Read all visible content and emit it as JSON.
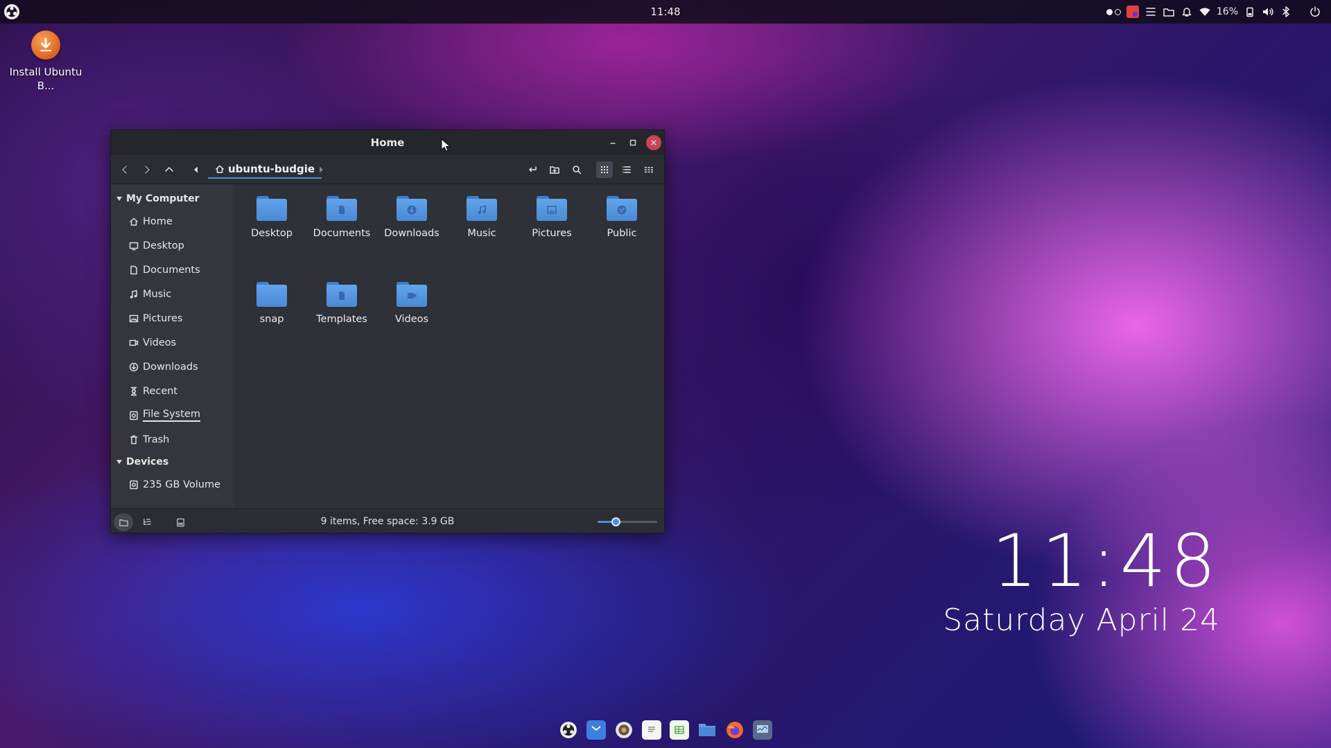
{
  "top_panel": {
    "clock": "11:48",
    "battery": "16%",
    "icons": [
      "budgie-menu-icon",
      "workspace-dots-icon",
      "app-indicator-icon",
      "hamburger-icon",
      "folder-icon",
      "bell-icon",
      "wifi-icon",
      "battery-icon",
      "volume-icon",
      "bluetooth-icon",
      "power-icon"
    ]
  },
  "desktop": {
    "install_label": "Install Ubuntu B...",
    "clock_time": "11:48",
    "clock_date": "Saturday April 24"
  },
  "window": {
    "title": "Home",
    "breadcrumb": "ubuntu-budgie",
    "sidebar": {
      "section_computer": "My Computer",
      "items": [
        {
          "label": "Home",
          "icon": "home-icon"
        },
        {
          "label": "Desktop",
          "icon": "desktop-icon"
        },
        {
          "label": "Documents",
          "icon": "document-icon"
        },
        {
          "label": "Music",
          "icon": "music-icon"
        },
        {
          "label": "Pictures",
          "icon": "picture-icon"
        },
        {
          "label": "Videos",
          "icon": "video-icon"
        },
        {
          "label": "Downloads",
          "icon": "download-icon"
        },
        {
          "label": "Recent",
          "icon": "hourglass-icon"
        },
        {
          "label": "File System",
          "icon": "drive-icon"
        },
        {
          "label": "Trash",
          "icon": "trash-icon"
        }
      ],
      "section_devices": "Devices",
      "devices": [
        {
          "label": "235 GB Volume",
          "icon": "drive-icon"
        }
      ]
    },
    "files": [
      {
        "label": "Desktop",
        "emblem": "none"
      },
      {
        "label": "Documents",
        "emblem": "document"
      },
      {
        "label": "Downloads",
        "emblem": "download"
      },
      {
        "label": "Music",
        "emblem": "music"
      },
      {
        "label": "Pictures",
        "emblem": "picture"
      },
      {
        "label": "Public",
        "emblem": "share"
      },
      {
        "label": "snap",
        "emblem": "none"
      },
      {
        "label": "Templates",
        "emblem": "document"
      },
      {
        "label": "Videos",
        "emblem": "video"
      }
    ],
    "status": "9 items, Free space: 3.9 GB",
    "zoom_level": 0.3,
    "accent_color": "#4a8fe0"
  },
  "dock": {
    "icons": [
      "budgie-icon",
      "mail-icon",
      "settings-icon",
      "text-editor-icon",
      "spreadsheet-icon",
      "files-icon",
      "firefox-icon",
      "system-monitor-icon"
    ]
  }
}
